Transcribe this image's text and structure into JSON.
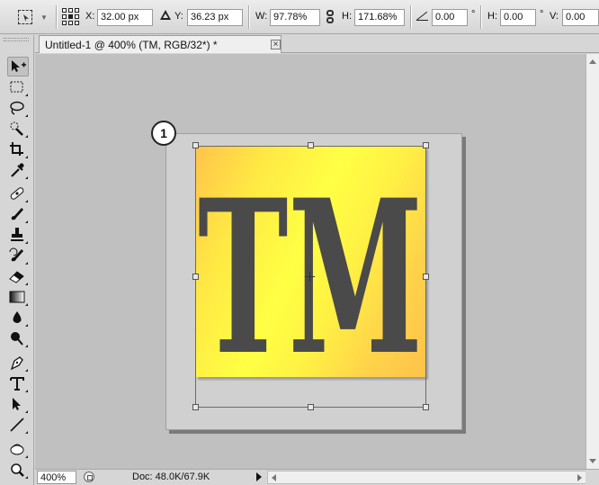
{
  "options_bar": {
    "x_label": "X:",
    "x_value": "32.00 px",
    "y_label": "Y:",
    "y_value": "36.23 px",
    "w_label": "W:",
    "w_value": "97.78%",
    "h_label": "H:",
    "h_value": "171.68%",
    "angle_value": "0.00",
    "angle_unit": "°",
    "skew_h_label": "H:",
    "skew_h_value": "0.00",
    "skew_h_unit": "°",
    "skew_v_label": "V:",
    "skew_v_value": "0.00"
  },
  "document": {
    "tab_title": "Untitled-1 @ 400% (TM, RGB/32*) *",
    "close_glyph": "×",
    "artwork_text": "TM",
    "callout_number": "1"
  },
  "status_bar": {
    "zoom": "400%",
    "doc_info": "Doc: 48.0K/67.9K"
  },
  "toolbox": {
    "tools": [
      "move",
      "marquee",
      "lasso",
      "quick-selection",
      "crop",
      "eyedropper",
      "healing-brush",
      "brush",
      "clone-stamp",
      "history-brush",
      "eraser",
      "gradient",
      "blur",
      "dodge",
      "pen",
      "type",
      "path-selection",
      "line",
      "rotate-view",
      "zoom"
    ]
  },
  "colors": {
    "canvas_bg": "#c0c0c0",
    "artwork_text": "#4a4a4a",
    "gradient_yellow": "#ffff44",
    "gradient_orange": "#ffc44a"
  }
}
